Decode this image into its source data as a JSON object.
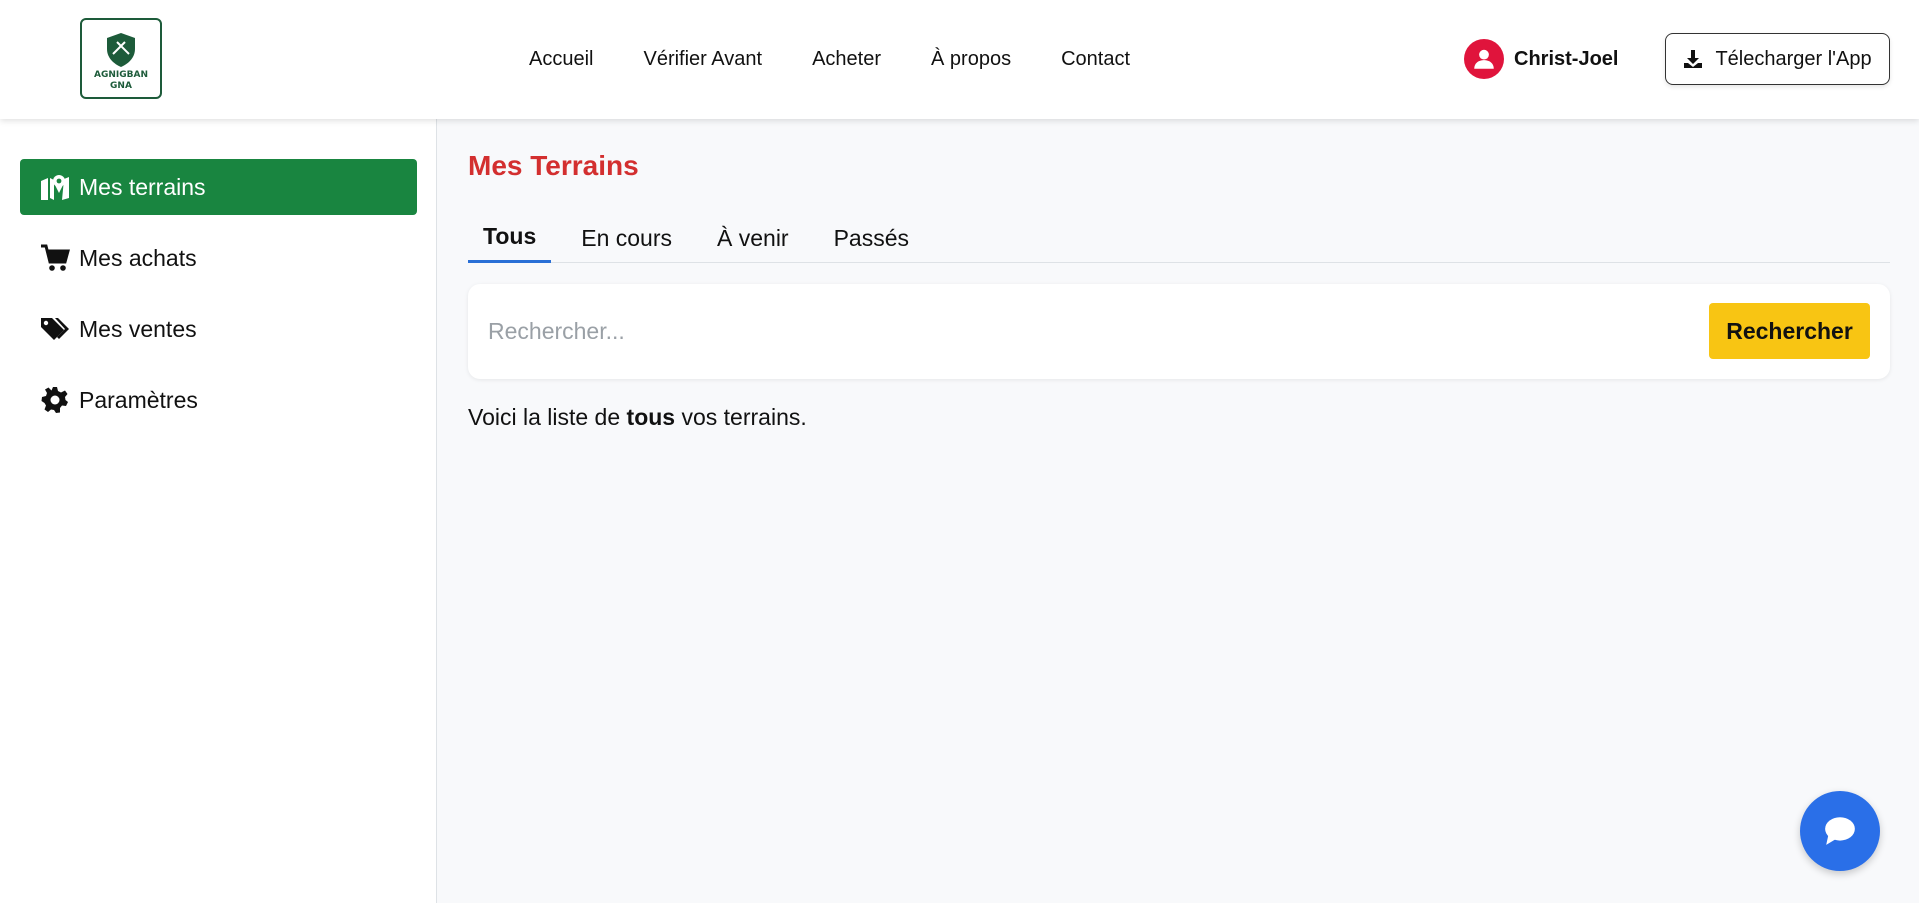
{
  "header": {
    "logo_text": "AGNIGBAN GNA",
    "nav": [
      "Accueil",
      "Vérifier Avant",
      "Acheter",
      "À propos",
      "Contact"
    ],
    "user_name": "Christ-Joel",
    "download_label": "Télecharger l'App"
  },
  "sidebar": {
    "items": [
      {
        "label": "Mes terrains",
        "icon": "map-marker-icon",
        "active": true
      },
      {
        "label": "Mes achats",
        "icon": "cart-icon",
        "active": false
      },
      {
        "label": "Mes ventes",
        "icon": "tags-icon",
        "active": false
      },
      {
        "label": "Paramètres",
        "icon": "gear-icon",
        "active": false
      }
    ]
  },
  "main": {
    "title": "Mes Terrains",
    "tabs": [
      "Tous",
      "En cours",
      "À venir",
      "Passés"
    ],
    "active_tab": "Tous",
    "search": {
      "placeholder": "Rechercher...",
      "value": "",
      "button_label": "Rechercher"
    },
    "description": {
      "before": "Voici la liste de ",
      "bold": "tous",
      "after": " vos terrains."
    }
  },
  "colors": {
    "brand_green": "#198540",
    "title_red": "#d32f2f",
    "accent_yellow": "#f8c513",
    "chat_blue": "#2a6fe8",
    "avatar_red": "#e0143c",
    "tab_underline": "#2a6fd6"
  }
}
